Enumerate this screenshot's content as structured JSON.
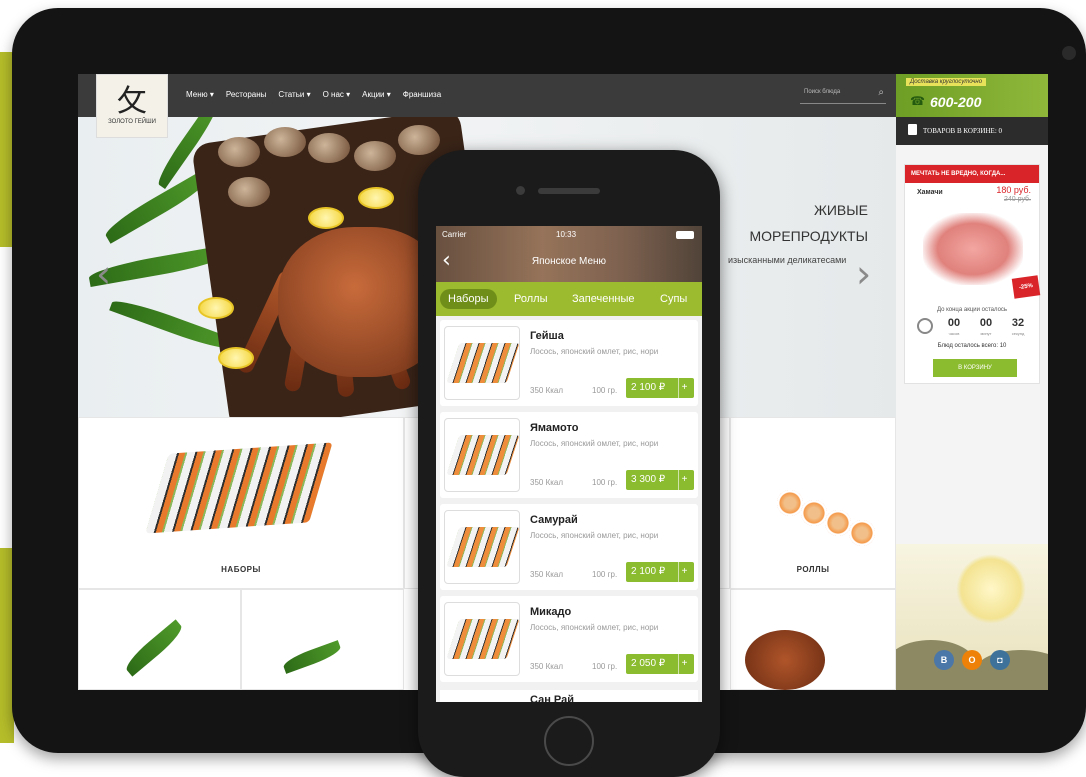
{
  "site": {
    "logo_glyph": "攵",
    "logo_text": "ЗОЛОТО ГЕЙШИ",
    "nav": [
      "Меню",
      "Рестораны",
      "Статьи",
      "О нас",
      "Акции",
      "Франшиза"
    ],
    "search_placeholder": "Поиск блюда",
    "hero": {
      "title_line1": "ЖИВЫЕ",
      "title_line2": "МОРЕПРОДУКТЫ",
      "subtitle": "изысканными деликатесами"
    },
    "categories": [
      "НАБОРЫ",
      "РОЛЛЫ"
    ],
    "sidebar": {
      "delivery_note": "Доставка круглосуточно",
      "phone": "600-200",
      "cart_text": "ТОВАРОВ В КОРЗИНЕ: 0",
      "promo_header": "МЕЧТАТЬ НЕ ВРЕДНО, КОГДА...",
      "promo_item": "Хамачи",
      "promo_price": "180 руб.",
      "promo_old_price": "240 руб.",
      "discount": "-25%",
      "promo_ends": "До конца акции осталось",
      "timer": [
        "00",
        "00",
        "32"
      ],
      "timer_labels": [
        "часов",
        "минут",
        "секунд"
      ],
      "dishes_left": "Блюд осталось всего: 10",
      "cart_button": "В КОРЗИНУ",
      "social": [
        "B",
        "O",
        "◘"
      ]
    }
  },
  "app": {
    "carrier": "Carrier",
    "time": "10:33",
    "title": "Японское Меню",
    "tabs": [
      "Наборы",
      "Роллы",
      "Запеченные",
      "Супы"
    ],
    "active_tab": 0,
    "items": [
      {
        "name": "Гейша",
        "desc": "Лосось, японский омлет, рис, нори",
        "kcal": "350 Ккал",
        "weight": "100 гр.",
        "price": "2 100 ₽"
      },
      {
        "name": "Ямамото",
        "desc": "Лосось, японский омлет, рис, нори",
        "kcal": "350 Ккал",
        "weight": "100 гр.",
        "price": "3 300 ₽"
      },
      {
        "name": "Самурай",
        "desc": "Лосось, японский омлет, рис, нори",
        "kcal": "350 Ккал",
        "weight": "100 гр.",
        "price": "2 100 ₽"
      },
      {
        "name": "Микадо",
        "desc": "Лосось, японский омлет, рис, нори",
        "kcal": "350 Ккал",
        "weight": "100 гр.",
        "price": "2 050 ₽"
      }
    ],
    "peek_name": "Сан Рай",
    "plus": "+"
  },
  "colors": {
    "accent_green": "#8bbb2e",
    "tab_bar": "#9dbb2e",
    "header_dark": "#3b3b3b",
    "promo_red": "#d9252a",
    "deco_bar": "#b5bd2a"
  }
}
